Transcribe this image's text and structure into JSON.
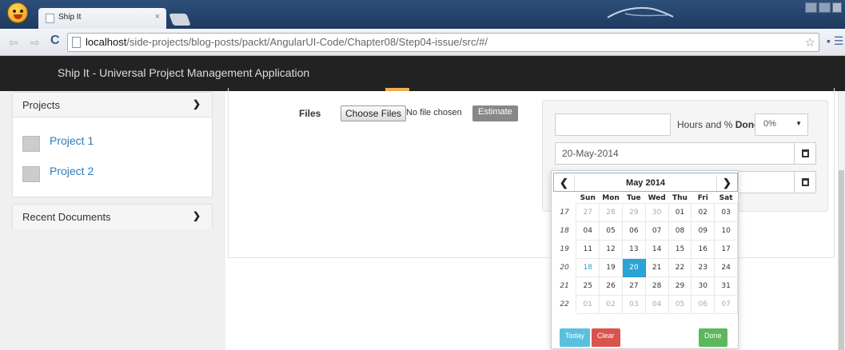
{
  "browser": {
    "tab_title": "Ship It",
    "tab_close": "×",
    "url_host": "localhost",
    "url_path": "/side-projects/blog-posts/packt/AngularUI-Code/Chapter08/Step04-issue/src/#/"
  },
  "app": {
    "title": "Ship It - Universal Project Management Application"
  },
  "sidebar": {
    "projects_heading": "Projects",
    "projects": [
      {
        "label": "Project 1"
      },
      {
        "label": "Project 2"
      }
    ],
    "recent_heading": "Recent Documents"
  },
  "form": {
    "files_label": "Files",
    "choose_files": "Choose Files",
    "no_file": "No file chosen",
    "estimate": "Estimate",
    "hours_label_prefix": "Hours and % ",
    "hours_label_bold": "Done",
    "done_value": "0%",
    "date_value": "20-May-2014"
  },
  "datepicker": {
    "title": "May 2014",
    "days": [
      "Sun",
      "Mon",
      "Tue",
      "Wed",
      "Thu",
      "Fri",
      "Sat"
    ],
    "weeks": [
      {
        "wk": "17",
        "days": [
          "27",
          "28",
          "29",
          "30",
          "01",
          "02",
          "03"
        ],
        "muted": [
          0,
          1,
          2,
          3
        ]
      },
      {
        "wk": "18",
        "days": [
          "04",
          "05",
          "06",
          "07",
          "08",
          "09",
          "10"
        ],
        "muted": []
      },
      {
        "wk": "19",
        "days": [
          "11",
          "12",
          "13",
          "14",
          "15",
          "16",
          "17"
        ],
        "muted": []
      },
      {
        "wk": "20",
        "days": [
          "18",
          "19",
          "20",
          "21",
          "22",
          "23",
          "24"
        ],
        "muted": []
      },
      {
        "wk": "21",
        "days": [
          "25",
          "26",
          "27",
          "28",
          "29",
          "30",
          "31"
        ],
        "muted": []
      },
      {
        "wk": "22",
        "days": [
          "01",
          "02",
          "03",
          "04",
          "05",
          "06",
          "07"
        ],
        "muted": [
          0,
          1,
          2,
          3,
          4,
          5,
          6
        ]
      }
    ],
    "selected": "20",
    "today_buttons": {
      "today": "Today",
      "clear": "Clear",
      "done": "Done"
    }
  },
  "colors": {
    "accent": "#2aa4d5",
    "today_btn": "#5bc0de",
    "clear_btn": "#d9534f",
    "done_btn": "#5cb85c",
    "link": "#2a7bbd",
    "header_bg": "#222222"
  }
}
